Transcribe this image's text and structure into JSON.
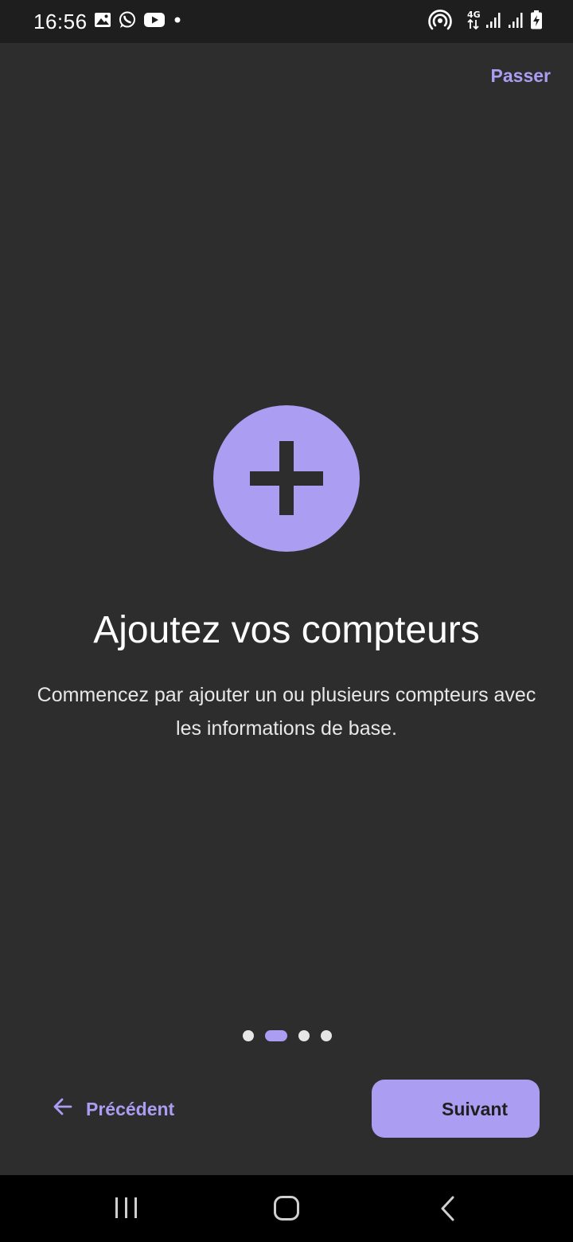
{
  "status_bar": {
    "time": "16:56",
    "left_icons": [
      "gallery-icon",
      "whatsapp-icon",
      "youtube-icon",
      "dot-icon"
    ],
    "right_icons": [
      "hotspot-icon",
      "4g-icon",
      "signal-icon",
      "signal-icon",
      "battery-charging-icon"
    ],
    "network_label": "4G"
  },
  "header": {
    "skip_label": "Passer"
  },
  "onboarding": {
    "icon": "plus-icon",
    "title": "Ajoutez vos compteurs",
    "description": "Commencez par ajouter un ou plusieurs compteurs avec les informations de base.",
    "page_count": 4,
    "current_page_index": 1
  },
  "footer": {
    "prev_label": "Précédent",
    "next_label": "Suivant"
  },
  "nav_bar": {
    "buttons": [
      "recents-icon",
      "home-icon",
      "back-icon"
    ]
  },
  "colors": {
    "accent": "#ab9df2",
    "background": "#2d2d2d",
    "status_bar": "#1e1e1e",
    "nav_bar": "#000000"
  }
}
